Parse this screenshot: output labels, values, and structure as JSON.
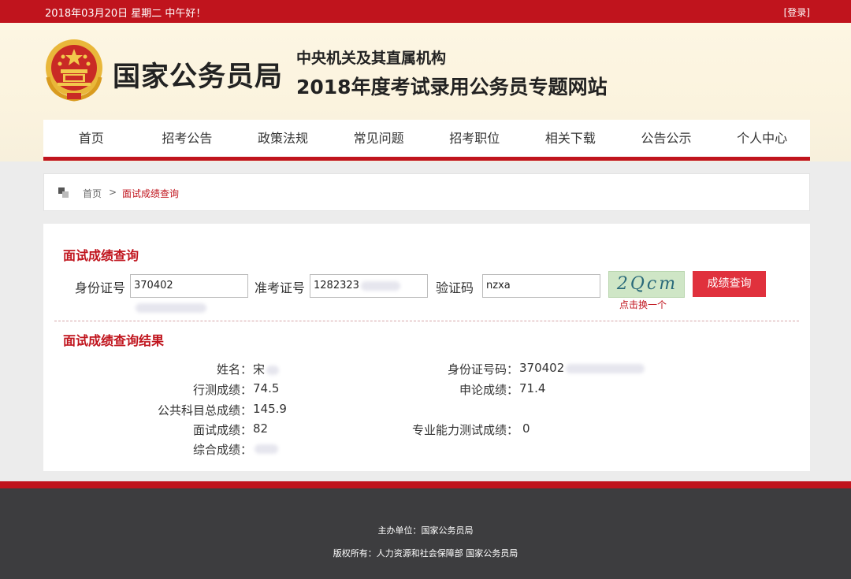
{
  "topbar": {
    "date": "2018年03月20日  星期二  中午好！",
    "login": "[登录]"
  },
  "header": {
    "site_name": "国家公务员局",
    "subtitle1": "中央机关及其直属机构",
    "subtitle2": "2018年度考试录用公务员专题网站"
  },
  "nav": {
    "items": [
      "首页",
      "招考公告",
      "政策法规",
      "常见问题",
      "招考职位",
      "相关下载",
      "公告公示",
      "个人中心"
    ]
  },
  "breadcrumb": {
    "home": "首页",
    "separator": ">",
    "current": "面试成绩查询"
  },
  "query": {
    "title": "面试成绩查询",
    "id_label": "身份证号",
    "id_value": "370402",
    "ticket_label": "准考证号",
    "ticket_value": "1282323",
    "captcha_label": "验证码",
    "captcha_value": "nzxa",
    "captcha_image_text": "2Qcm",
    "refresh_label": "点击换一个",
    "button": "成绩查询"
  },
  "result": {
    "title": "面试成绩查询结果",
    "name_key": "姓名：",
    "name_value": "宋",
    "id_key": "身份证号码：",
    "id_value": "370402",
    "xingce_key": "行测成绩：",
    "xingce_value": "74.5",
    "shenlun_key": "申论成绩：",
    "shenlun_value": "71.4",
    "public_total_key": "公共科目总成绩：",
    "public_total_value": "145.9",
    "interview_key": "面试成绩：",
    "interview_value": "82",
    "professional_key": "专业能力测试成绩：",
    "professional_value": "0",
    "overall_key": "综合成绩：",
    "overall_value": ""
  },
  "footer": {
    "host": "主办单位：国家公务员局",
    "copyright": "版权所有：人力资源和社会保障部   国家公务员局"
  },
  "colors": {
    "brand_red": "#c0141d",
    "button_red": "#e0313d",
    "footer_bg": "#3d3d3f"
  }
}
